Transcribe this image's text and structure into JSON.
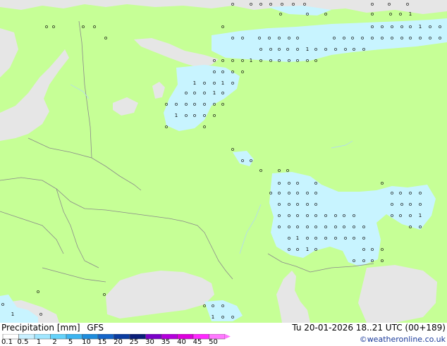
{
  "legend": {
    "product": "Precipitation [mm]",
    "model": "GFS",
    "valid_time": "Tu 20-01-2026 18..21 UTC (00+189)",
    "credit": "©weatheronline.co.uk",
    "scale_labels": [
      "0.1",
      "0.5",
      "1",
      "2",
      "5",
      "10",
      "15",
      "20",
      "25",
      "30",
      "35",
      "40",
      "45",
      "50"
    ],
    "scale_colors": [
      "#ffffff",
      "#c8f0ff",
      "#a0e6ff",
      "#64d2fa",
      "#3cb4f0",
      "#1e8cdc",
      "#1464c8",
      "#0a3ca0",
      "#0a1e78",
      "#7a00c8",
      "#b400dc",
      "#dc00dc",
      "#ff28ff",
      "#ff78ff"
    ]
  },
  "colors": {
    "land": "#c6ff96",
    "sea": "#e6e6e6",
    "precip_light": "#c8f4ff",
    "border": "#8a8a8a"
  },
  "map_markers": {
    "precip_symbols": [
      "o",
      "1",
      "0"
    ]
  }
}
